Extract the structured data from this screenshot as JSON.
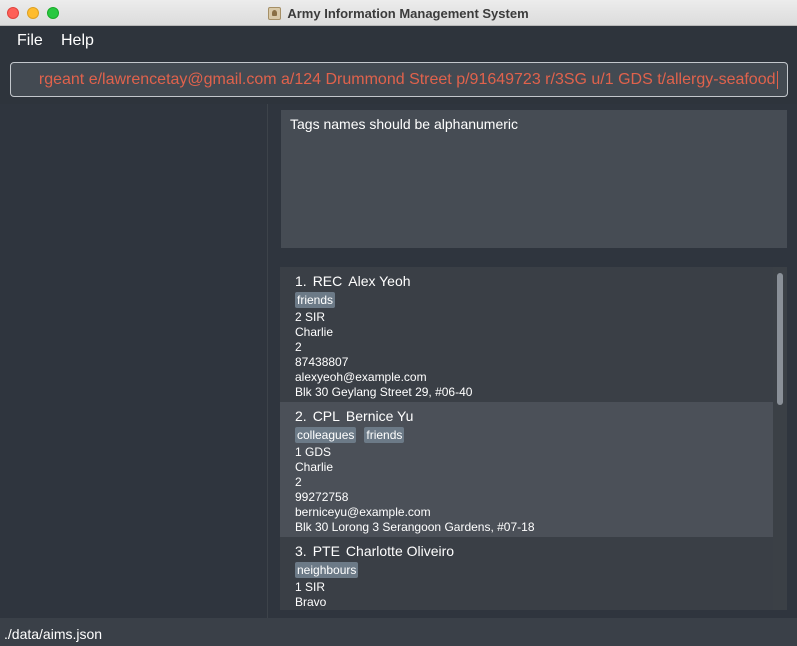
{
  "window": {
    "title": "Army Information Management System",
    "app_icon": "contacts-book-icon"
  },
  "menu": {
    "file": "File",
    "help": "Help"
  },
  "command": {
    "value": "rgeant e/lawrencetay@gmail.com a/124 Drummond Street p/91649723 r/3SG u/1 GDS t/allergy-seafood"
  },
  "result": {
    "message": "Tags names should be alphanumeric"
  },
  "persons": [
    {
      "index": "1.",
      "rank": "REC",
      "name": "Alex Yeoh",
      "tags": [
        "friends"
      ],
      "unit": "2 SIR",
      "company": "Charlie",
      "platoon": "2",
      "phone": "87438807",
      "email": "alexyeoh@example.com",
      "address": "Blk 30 Geylang Street 29, #06-40"
    },
    {
      "index": "2.",
      "rank": "CPL",
      "name": "Bernice Yu",
      "tags": [
        "colleagues",
        "friends"
      ],
      "unit": "1 GDS",
      "company": "Charlie",
      "platoon": "2",
      "phone": "99272758",
      "email": "berniceyu@example.com",
      "address": "Blk 30 Lorong 3 Serangoon Gardens, #07-18"
    },
    {
      "index": "3.",
      "rank": "PTE",
      "name": "Charlotte Oliveiro",
      "tags": [
        "neighbours"
      ],
      "unit": "1 SIR",
      "company": "Bravo",
      "platoon": "",
      "phone": "",
      "email": "",
      "address": ""
    }
  ],
  "status": {
    "path": "./data/aims.json"
  },
  "colors": {
    "command_text": "#e0624c",
    "tag_bg": "#6c7a87",
    "background": "#2f353e"
  }
}
